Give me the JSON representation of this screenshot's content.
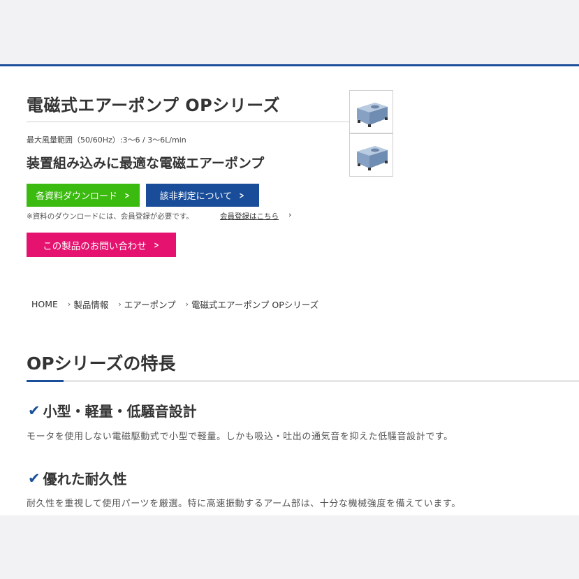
{
  "product": {
    "title": "電磁式エアーポンプ OPシリーズ",
    "spec": "最大風量範囲（50/60Hz）:3〜6 / 3〜6L/min",
    "catch": "装置組み込みに最適な電磁エアーポンプ",
    "thumbnails": [
      "air-pump-thumbnail",
      "air-pump-thumbnail"
    ]
  },
  "buttons": {
    "download_label": "各資料ダウンロード",
    "judgement_label": "該非判定について",
    "inquiry_label": "この製品のお問い合わせ"
  },
  "note": {
    "text": "※資料のダウンロードには、会員登録が必要です。",
    "link_label": "会員登録はこちら"
  },
  "breadcrumb": {
    "home": "HOME",
    "products": "製品情報",
    "category": "エアーポンプ",
    "current": "電磁式エアーポンプ OPシリーズ"
  },
  "features": {
    "title": "OPシリーズの特長",
    "items": [
      {
        "heading": "小型・軽量・低騒音設計",
        "text": "モータを使用しない電磁駆動式で小型で軽量。しかも吸込・吐出の通気音を抑えた低騒音設計です。"
      },
      {
        "heading": "優れた耐久性",
        "text": "耐久性を重視して使用パーツを厳選。特に高速振動するアーム部は、十分な機械強度を備えています。"
      }
    ]
  },
  "colors": {
    "accent_blue": "#1a4f9c",
    "green": "#3bba0f",
    "pink": "#e5136f"
  }
}
